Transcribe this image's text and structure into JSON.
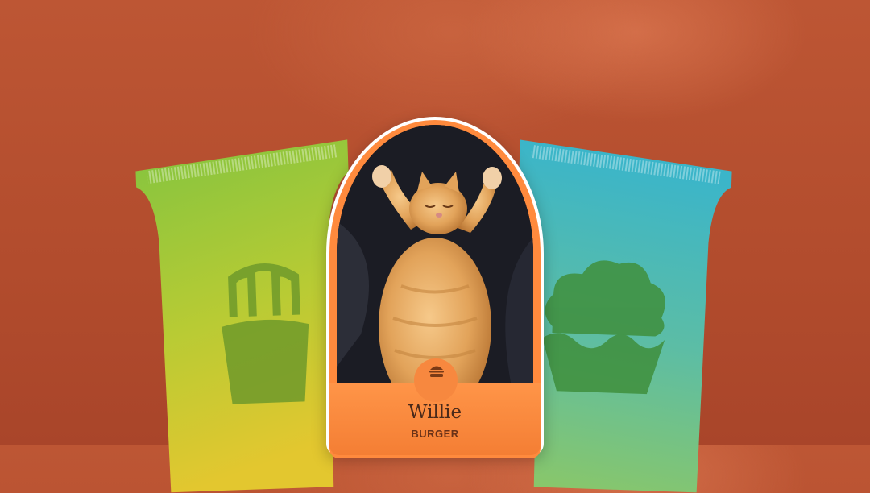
{
  "card": {
    "pet_name": "Willie",
    "pet_type": "BURGER",
    "badge_icon": "burger-icon"
  },
  "packs": [
    {
      "position": "left",
      "icon": "fries-icon",
      "gradient": [
        "#8fc63f",
        "#d8d13b"
      ]
    },
    {
      "position": "right",
      "icon": "muffin-icon",
      "gradient": [
        "#3bb3c8",
        "#84c869"
      ]
    }
  ],
  "colors": {
    "background": "#b24c2d",
    "card_accent": "#ff8a3d",
    "label_text": "#4a2a1a"
  }
}
